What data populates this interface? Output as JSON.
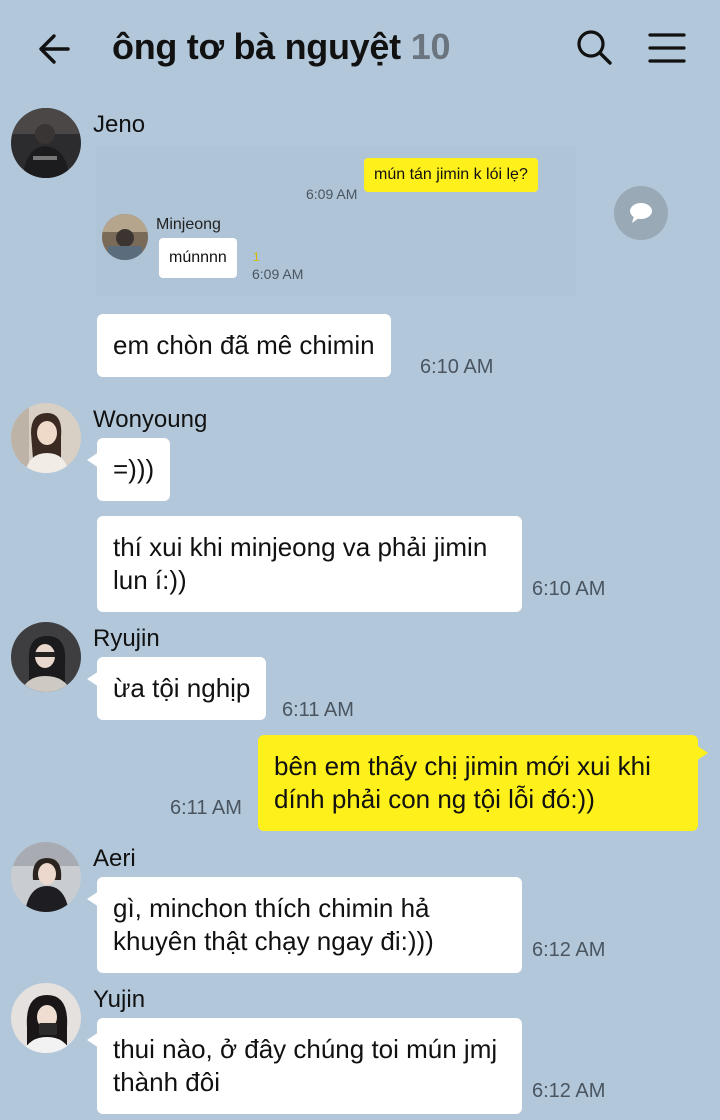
{
  "header": {
    "title": "ông tơ bà nguyệt",
    "member_count": "10",
    "back_icon": "arrow-left-icon",
    "search_icon": "search-icon",
    "menu_icon": "hamburger-menu-icon"
  },
  "colors": {
    "background": "#b2c7da",
    "my_bubble": "#fef01b",
    "other_bubble": "#ffffff"
  },
  "messages": [
    {
      "sender": "Jeno",
      "embedded_screenshot": {
        "question": "mún tán jimin k lói lẹ?",
        "question_time": "6:09 AM",
        "reply_sender": "Minjeong",
        "reply": "múnnnn",
        "reply_unread": "1",
        "reply_time": "6:09 AM"
      },
      "text": "em chòn đã mê chimin",
      "time": "6:10 AM"
    },
    {
      "sender": "Wonyoung",
      "text_1": "=)))",
      "text_2": "thí xui khi minjeong va phải jimin lun í:))",
      "time": "6:10 AM"
    },
    {
      "sender": "Ryujin",
      "text": "ừa tội nghịp",
      "time": "6:11 AM"
    },
    {
      "sender": "me",
      "text": "bên em thấy chị jimin mới xui khi dính phải con ng tội lỗi đó:))",
      "time": "6:11 AM"
    },
    {
      "sender": "Aeri",
      "text": "gì, minchon thích chimin hả khuyên thật chạy ngay đi:)))",
      "time": "6:12 AM"
    },
    {
      "sender": "Yujin",
      "text": "thui nào, ở đây chúng toi mún jmj thành đôi",
      "time": "6:12 AM"
    }
  ]
}
